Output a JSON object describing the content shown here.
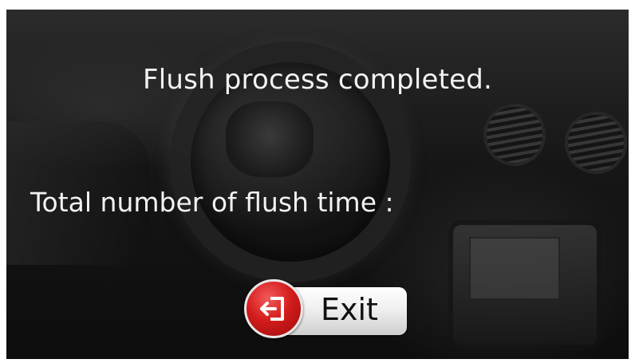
{
  "dialog": {
    "message": "Flush process completed.",
    "total_label": "Total number of flush time :",
    "total_value": ""
  },
  "exit_button": {
    "label": "Exit",
    "icon": "exit-door-arrow-icon",
    "icon_color": "#d41c1c"
  },
  "colors": {
    "text": "#f2f2f2",
    "background": "#161616"
  }
}
